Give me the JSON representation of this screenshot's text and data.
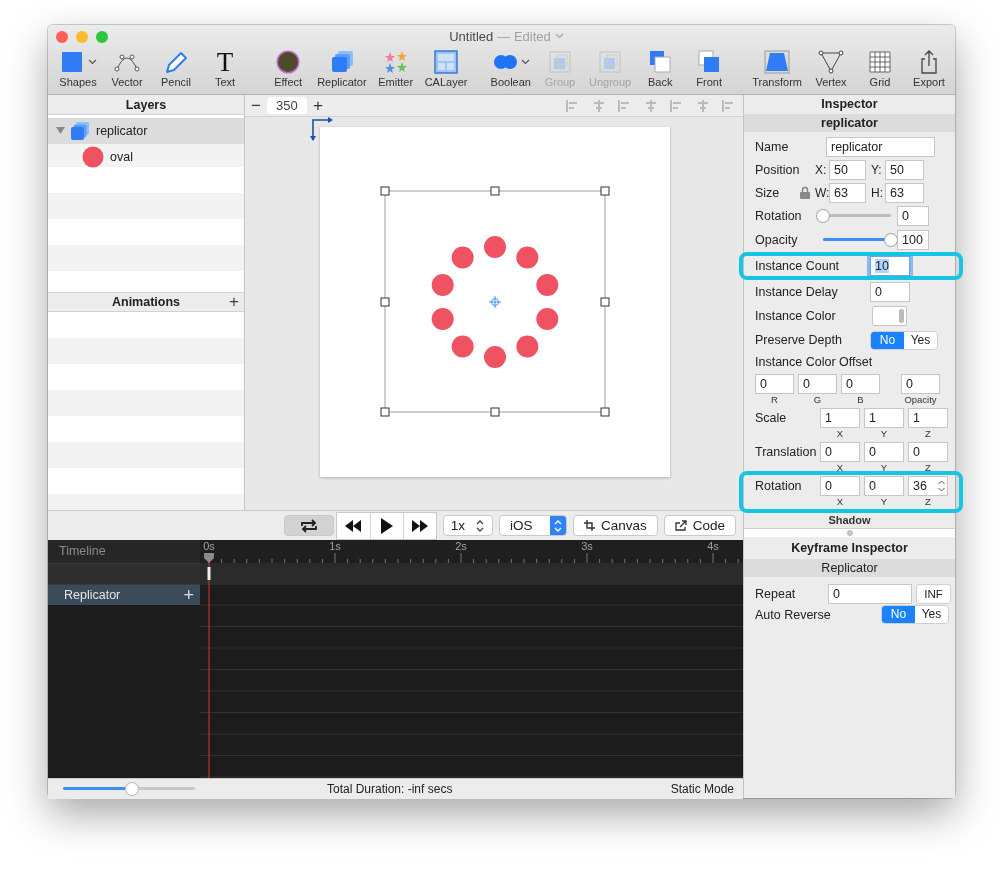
{
  "window": {
    "title": "Untitled",
    "status": "— Edited"
  },
  "toolbar": [
    {
      "items": [
        {
          "label": "Shapes",
          "kind": "shapes",
          "menu": true,
          "disabled": false
        },
        {
          "label": "Vector",
          "kind": "vector",
          "menu": false,
          "disabled": false
        },
        {
          "label": "Pencil",
          "kind": "pencil",
          "menu": false,
          "disabled": false
        },
        {
          "label": "Text",
          "kind": "text",
          "glyph": "T",
          "menu": false,
          "disabled": false
        }
      ]
    },
    {
      "items": [
        {
          "label": "Effect",
          "kind": "effect",
          "menu": false,
          "disabled": false
        },
        {
          "label": "Replicator",
          "kind": "replicator",
          "menu": false,
          "disabled": false
        },
        {
          "label": "Emitter",
          "kind": "emitter",
          "menu": false,
          "disabled": false
        },
        {
          "label": "CALayer",
          "kind": "calayer",
          "menu": false,
          "disabled": false
        }
      ]
    },
    {
      "items": [
        {
          "label": "Boolean",
          "kind": "boolean",
          "menu": true,
          "disabled": false
        },
        {
          "label": "Group",
          "kind": "group",
          "menu": false,
          "disabled": true
        },
        {
          "label": "Ungroup",
          "kind": "ungroup",
          "menu": false,
          "disabled": true
        },
        {
          "label": "Back",
          "kind": "back",
          "menu": false,
          "disabled": false
        },
        {
          "label": "Front",
          "kind": "front",
          "menu": false,
          "disabled": false
        }
      ]
    },
    {
      "items": [
        {
          "label": "Transform",
          "kind": "transform",
          "menu": false,
          "disabled": false
        },
        {
          "label": "Vertex",
          "kind": "vertex",
          "menu": false,
          "disabled": false
        },
        {
          "label": "Grid",
          "kind": "grid",
          "menu": false,
          "disabled": false
        },
        {
          "label": "Export",
          "kind": "export",
          "menu": false,
          "disabled": false
        }
      ]
    }
  ],
  "layers": {
    "title": "Layers",
    "items": [
      {
        "name": "replicator",
        "kind": "replicator",
        "selected": true,
        "expanded": true,
        "children": [
          {
            "name": "oval",
            "kind": "oval",
            "selected": false
          }
        ]
      }
    ]
  },
  "animations": {
    "title": "Animations",
    "add": "+"
  },
  "canvas": {
    "zoom_out": "−",
    "zoom": "350",
    "zoom_in": "+"
  },
  "playback": {
    "loop_on": true,
    "speed": "1x",
    "platform": "iOS",
    "canvas": "Canvas",
    "code": "Code"
  },
  "timeline": {
    "title": "Timeline",
    "ticks": [
      "0s",
      "1s",
      "2s",
      "3s",
      "4s"
    ],
    "tracks": [
      {
        "name": "Replicator",
        "selected": true,
        "add": "+"
      }
    ]
  },
  "status_bar": {
    "zoom_slider": {
      "level": 0.52
    },
    "duration": "Total Duration: -inf secs",
    "mode": "Static Mode"
  },
  "inspector": {
    "title": "Inspector",
    "subtitle": "replicator",
    "rows": [
      {
        "kind": "text",
        "label": "Name",
        "value": "replicator"
      },
      {
        "kind": "pair",
        "label": "Position",
        "locked": false,
        "fields": [
          {
            "prefix": "X:",
            "value": "50"
          },
          {
            "prefix": "Y:",
            "value": "50"
          }
        ]
      },
      {
        "kind": "pair",
        "label": "Size",
        "locked": true,
        "fields": [
          {
            "prefix": "W:",
            "value": "63"
          },
          {
            "prefix": "H:",
            "value": "63"
          }
        ]
      },
      {
        "kind": "slider",
        "label": "Rotation",
        "level": 0,
        "value": "0"
      },
      {
        "kind": "slider",
        "label": "Opacity",
        "level": 1,
        "value": "100"
      },
      {
        "kind": "number",
        "label": "Instance Count",
        "value": "10",
        "focused": true,
        "highlight": true
      },
      {
        "kind": "number",
        "label": "Instance Delay",
        "value": "0",
        "focused": false,
        "highlight": false
      },
      {
        "kind": "color",
        "label": "Instance Color"
      },
      {
        "kind": "toggle",
        "label": "Preserve Depth",
        "options": [
          {
            "label": "No",
            "selected": true
          },
          {
            "label": "Yes",
            "selected": false
          }
        ]
      },
      {
        "kind": "heading",
        "label": "Instance Color Offset"
      },
      {
        "kind": "quad",
        "fields": [
          {
            "value": "0",
            "caption": "R"
          },
          {
            "value": "0",
            "caption": "G"
          },
          {
            "value": "0",
            "caption": "B"
          },
          {
            "value": "0",
            "caption": "Opacity"
          }
        ]
      },
      {
        "kind": "triple",
        "label": "Scale",
        "stepper": false,
        "highlight": false,
        "fields": [
          {
            "value": "1",
            "caption": "X"
          },
          {
            "value": "1",
            "caption": "Y"
          },
          {
            "value": "1",
            "caption": "Z"
          }
        ]
      },
      {
        "kind": "triple",
        "label": "Translation",
        "stepper": false,
        "highlight": false,
        "fields": [
          {
            "value": "0",
            "caption": "X"
          },
          {
            "value": "0",
            "caption": "Y"
          },
          {
            "value": "0",
            "caption": "Z"
          }
        ]
      },
      {
        "kind": "triple",
        "label": "Rotation",
        "stepper": true,
        "highlight": true,
        "fields": [
          {
            "value": "0",
            "caption": "X"
          },
          {
            "value": "0",
            "caption": "Y"
          },
          {
            "value": "36",
            "caption": "Z"
          }
        ]
      }
    ],
    "section": "Shadow"
  },
  "keyframe_inspector": {
    "title": "Keyframe Inspector",
    "subtitle": "Replicator",
    "rows": [
      {
        "kind": "repeat",
        "label": "Repeat",
        "value": "0",
        "button": "INF"
      },
      {
        "kind": "toggle",
        "label": "Auto Reverse",
        "options": [
          {
            "label": "No",
            "selected": true
          },
          {
            "label": "Yes",
            "selected": false
          }
        ]
      }
    ]
  }
}
